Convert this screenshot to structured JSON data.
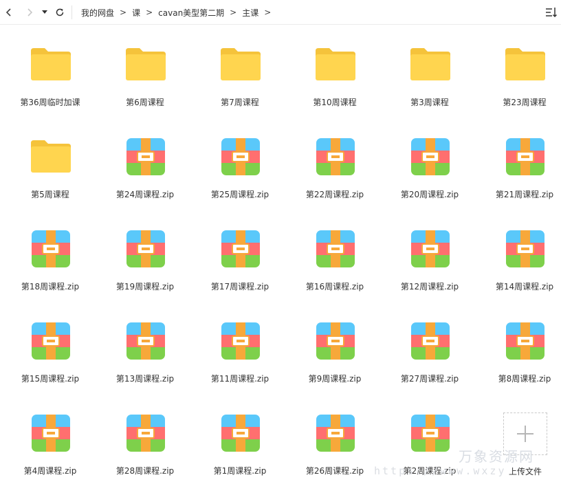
{
  "toolbar": {
    "back_icon": "chevron-left-icon",
    "forward_icon": "chevron-right-icon",
    "dropdown_icon": "caret-down-icon",
    "refresh_icon": "refresh-icon",
    "sort_icon": "sort-icon"
  },
  "breadcrumb": [
    "我的网盘",
    "课",
    "cavan美型第二期",
    "主课"
  ],
  "breadcrumb_separator": ">",
  "files": [
    {
      "name": "第36周临时加课",
      "type": "folder"
    },
    {
      "name": "第6周课程",
      "type": "folder"
    },
    {
      "name": "第7周课程",
      "type": "folder"
    },
    {
      "name": "第10周课程",
      "type": "folder"
    },
    {
      "name": "第3周课程",
      "type": "folder"
    },
    {
      "name": "第23周课程",
      "type": "folder"
    },
    {
      "name": "第5周课程",
      "type": "folder"
    },
    {
      "name": "第24周课程.zip",
      "type": "zip"
    },
    {
      "name": "第25周课程.zip",
      "type": "zip"
    },
    {
      "name": "第22周课程.zip",
      "type": "zip"
    },
    {
      "name": "第20周课程.zip",
      "type": "zip"
    },
    {
      "name": "第21周课程.zip",
      "type": "zip"
    },
    {
      "name": "第18周课程.zip",
      "type": "zip"
    },
    {
      "name": "第19周课程.zip",
      "type": "zip"
    },
    {
      "name": "第17周课程.zip",
      "type": "zip"
    },
    {
      "name": "第16周课程.zip",
      "type": "zip"
    },
    {
      "name": "第12周课程.zip",
      "type": "zip"
    },
    {
      "name": "第14周课程.zip",
      "type": "zip"
    },
    {
      "name": "第15周课程.zip",
      "type": "zip"
    },
    {
      "name": "第13周课程.zip",
      "type": "zip"
    },
    {
      "name": "第11周课程.zip",
      "type": "zip"
    },
    {
      "name": "第9周课程.zip",
      "type": "zip"
    },
    {
      "name": "第27周课程.zip",
      "type": "zip"
    },
    {
      "name": "第8周课程.zip",
      "type": "zip"
    },
    {
      "name": "第4周课程.zip",
      "type": "zip"
    },
    {
      "name": "第28周课程.zip",
      "type": "zip"
    },
    {
      "name": "第1周课程.zip",
      "type": "zip"
    },
    {
      "name": "第26周课程.zip",
      "type": "zip"
    },
    {
      "name": "第2周课程.zip",
      "type": "zip"
    }
  ],
  "upload": {
    "label": "上传文件",
    "icon": "plus-icon"
  },
  "watermark": {
    "line1": "万象资源网",
    "line2": "https://www.wxzy"
  },
  "colors": {
    "folder_back": "#f5c33b",
    "folder_front": "#ffd54f",
    "zip_blue": "#5ac8fa",
    "zip_red": "#ff6f6f",
    "zip_green": "#7ed04b",
    "zip_strap": "#f7a83a"
  }
}
